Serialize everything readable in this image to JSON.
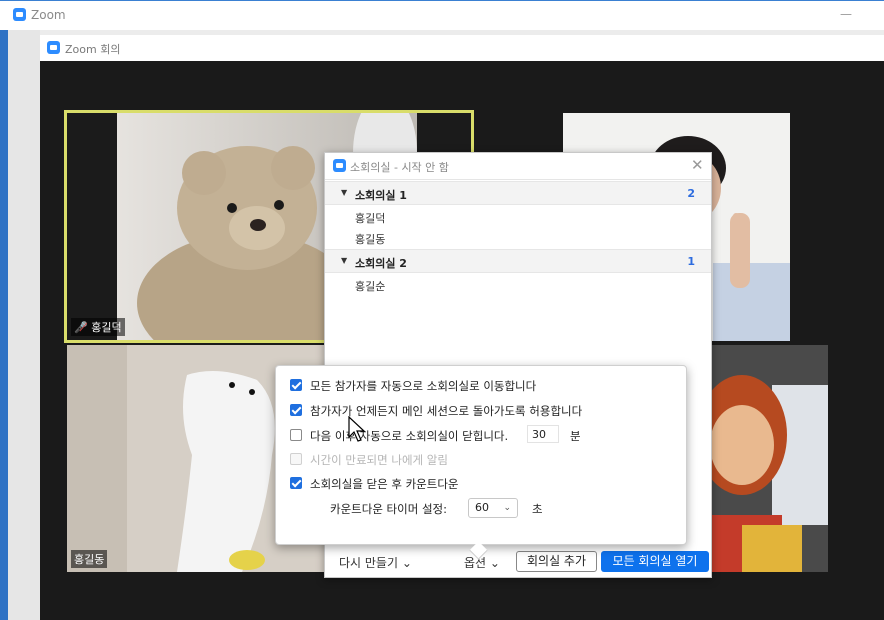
{
  "outer_window": {
    "title": "Zoom",
    "minimize_glyph": "—"
  },
  "meeting_window": {
    "title": "Zoom 회의"
  },
  "participants": [
    {
      "name": "홍길덕",
      "muted": true
    },
    {
      "name": "홍길동"
    }
  ],
  "breakout_dialog": {
    "title": "소회의실 - 시작 안 함",
    "close_glyph": "✕",
    "rooms": [
      {
        "name": "소회의실 1",
        "count": "2",
        "members": [
          "홍길덕",
          "홍길동"
        ]
      },
      {
        "name": "소회의실 2",
        "count": "1",
        "members": [
          "홍길순"
        ]
      }
    ],
    "footer": {
      "recreate_label": "다시 만들기 ⌄",
      "options_label": "옵션 ⌄",
      "add_room_label": "회의실 추가",
      "open_all_label": "모든 회의실 열기"
    }
  },
  "options_popup": {
    "items": [
      {
        "label": "모든 참가자를 자동으로 소회의실로 이동합니다",
        "checked": true,
        "enabled": true
      },
      {
        "label": "참가자가 언제든지 메인 세션으로 돌아가도록 허용합니다",
        "checked": true,
        "enabled": true
      },
      {
        "label": "다음 이후 자동으로 소회의실이 닫힙니다.",
        "checked": false,
        "enabled": true,
        "value": "30",
        "unit": "분"
      },
      {
        "label": "시간이 만료되면 나에게 알림",
        "checked": false,
        "enabled": false
      },
      {
        "label": "소회의실을 닫은 후 카운트다운",
        "checked": true,
        "enabled": true
      }
    ],
    "countdown": {
      "label": "카운트다운 타이머 설정:",
      "value": "60",
      "unit": "초"
    }
  },
  "colors": {
    "accent": "#0e72ed",
    "checkbox": "#1f6fdf",
    "speaker_border": "#d9dd6a"
  }
}
